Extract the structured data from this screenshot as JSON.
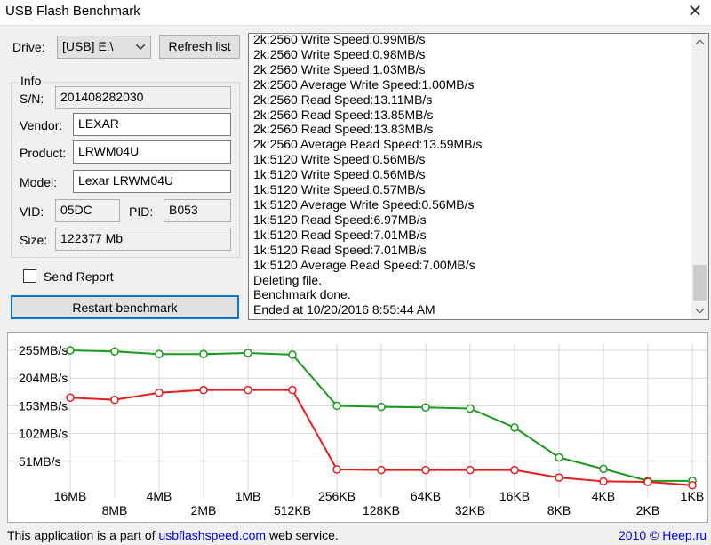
{
  "window": {
    "title": "USB Flash Benchmark",
    "close_glyph": "✕"
  },
  "drive": {
    "label": "Drive:",
    "value": "[USB] E:\\",
    "refresh_label": "Refresh list"
  },
  "info": {
    "group_label": "Info",
    "sn_label": "S/N:",
    "sn_value": "201408282030",
    "vendor_label": "Vendor:",
    "vendor_value": "LEXAR",
    "product_label": "Product:",
    "product_value": "LRWM04U",
    "model_label": "Model:",
    "model_value": "Lexar LRWM04U",
    "vid_label": "VID:",
    "vid_value": "05DC",
    "pid_label": "PID:",
    "pid_value": "B053",
    "size_label": "Size:",
    "size_value": "122377 Mb"
  },
  "send_report_label": "Send Report",
  "restart_label": "Restart benchmark",
  "log_lines": [
    "2k:2560 Write Speed:0.99MB/s",
    "2k:2560 Write Speed:0.98MB/s",
    "2k:2560 Write Speed:1.03MB/s",
    "2k:2560 Average Write Speed:1.00MB/s",
    "2k:2560 Read Speed:13.11MB/s",
    "2k:2560 Read Speed:13.85MB/s",
    "2k:2560 Read Speed:13.83MB/s",
    "2k:2560 Average Read Speed:13.59MB/s",
    "1k:5120 Write Speed:0.56MB/s",
    "1k:5120 Write Speed:0.56MB/s",
    "1k:5120 Write Speed:0.57MB/s",
    "1k:5120 Average Write Speed:0.56MB/s",
    "1k:5120 Read Speed:6.97MB/s",
    "1k:5120 Read Speed:7.01MB/s",
    "1k:5120 Read Speed:7.01MB/s",
    "1k:5120 Average Read Speed:7.00MB/s",
    "Deleting file.",
    "Benchmark done.",
    "Ended at 10/20/2016 8:55:44 AM"
  ],
  "chart_data": {
    "type": "line",
    "categories": [
      "16MB",
      "8MB",
      "4MB",
      "2MB",
      "1MB",
      "512KB",
      "256KB",
      "128KB",
      "64KB",
      "32KB",
      "16KB",
      "8KB",
      "4KB",
      "2KB",
      "1KB"
    ],
    "y_tick_labels": [
      "255MB/s",
      "204MB/s",
      "153MB/s",
      "102MB/s",
      "51MB/s"
    ],
    "y_ticks": [
      255,
      204,
      153,
      102,
      51
    ],
    "ylim": [
      0,
      255
    ],
    "grid": true,
    "series": [
      {
        "name": "",
        "color": "#1a9a1a",
        "values": [
          255,
          253,
          248,
          248,
          250,
          247,
          153,
          151,
          150,
          148,
          113,
          58,
          37,
          15,
          15
        ]
      },
      {
        "name": "",
        "color": "#e81c1c",
        "values": [
          168,
          164,
          177,
          182,
          182,
          182,
          36,
          35,
          35,
          35,
          35,
          21,
          14,
          13,
          7
        ]
      }
    ]
  },
  "status": {
    "text_before": "This application is a part of ",
    "link": "usbflashspeed.com",
    "text_after": " web service.",
    "right_year": "2010 © ",
    "right_link": "Heep.ru"
  }
}
